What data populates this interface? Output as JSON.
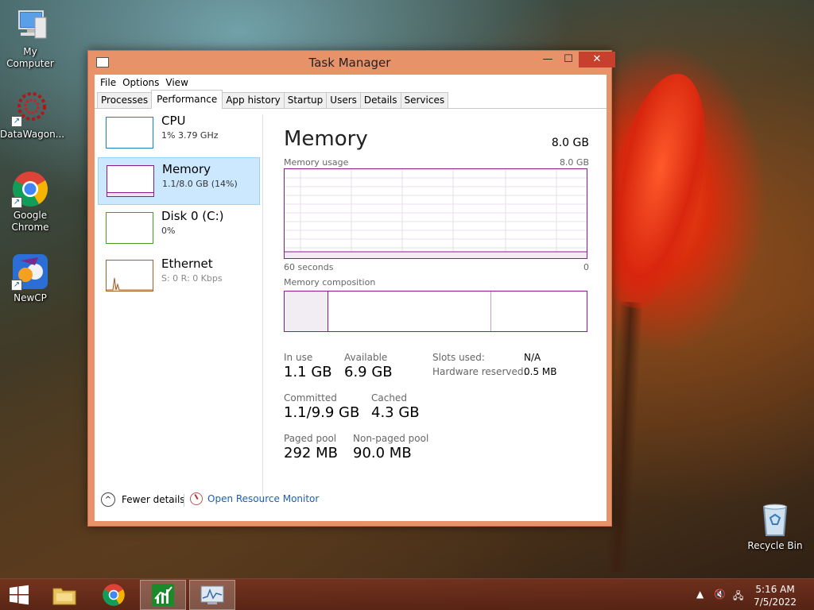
{
  "desktop": {
    "icons": [
      {
        "label": "My Computer"
      },
      {
        "label": "DataWagon..."
      },
      {
        "label": "Google Chrome"
      },
      {
        "label": "NewCP"
      },
      {
        "label": "Recycle Bin"
      }
    ]
  },
  "window": {
    "title": "Task Manager",
    "minimize": "—",
    "maximize": "☐",
    "close": "✕"
  },
  "menu": [
    "File",
    "Options",
    "View"
  ],
  "tabs": [
    "Processes",
    "Performance",
    "App history",
    "Startup",
    "Users",
    "Details",
    "Services"
  ],
  "active_tab": "Performance",
  "sidebar": {
    "cpu": {
      "title": "CPU",
      "sub": "1%  3.79 GHz"
    },
    "memory": {
      "title": "Memory",
      "sub": "1.1/8.0 GB (14%)"
    },
    "disk": {
      "title": "Disk 0 (C:)",
      "sub": "0%"
    },
    "ethernet": {
      "title": "Ethernet",
      "sub_prefix": "S: 0  R: 0 Kbps"
    }
  },
  "memory": {
    "title": "Memory",
    "total": "8.0 GB",
    "usage_label": "Memory usage",
    "usage_max": "8.0 GB",
    "axis_left": "60 seconds",
    "axis_right": "0",
    "composition_label": "Memory composition",
    "in_use_fraction": 0.14,
    "in_use_label": "In use",
    "in_use_value": "1.1 GB",
    "available_label": "Available",
    "available_value": "6.9 GB",
    "committed_label": "Committed",
    "committed_value": "1.1/9.9 GB",
    "cached_label": "Cached",
    "cached_value": "4.3 GB",
    "paged_label": "Paged pool",
    "paged_value": "292 MB",
    "nonpaged_label": "Non-paged pool",
    "nonpaged_value": "90.0 MB",
    "slots_label": "Slots used:",
    "slots_value": "N/A",
    "hw_label": "Hardware reserved:",
    "hw_value": "0.5 MB"
  },
  "footer": {
    "fewer": "Fewer details",
    "resmon": "Open Resource Monitor"
  },
  "taskbar": {
    "time": "5:16 AM",
    "date": "7/5/2022"
  },
  "colors": {
    "memory_accent": "#8b1a8b",
    "cpu_accent": "#1a7fc1",
    "disk_accent": "#4a9a20",
    "ethernet_accent": "#a0602a",
    "window_frame": "#e8926a",
    "close_button": "#c7402e",
    "selection": "#cce8ff"
  }
}
